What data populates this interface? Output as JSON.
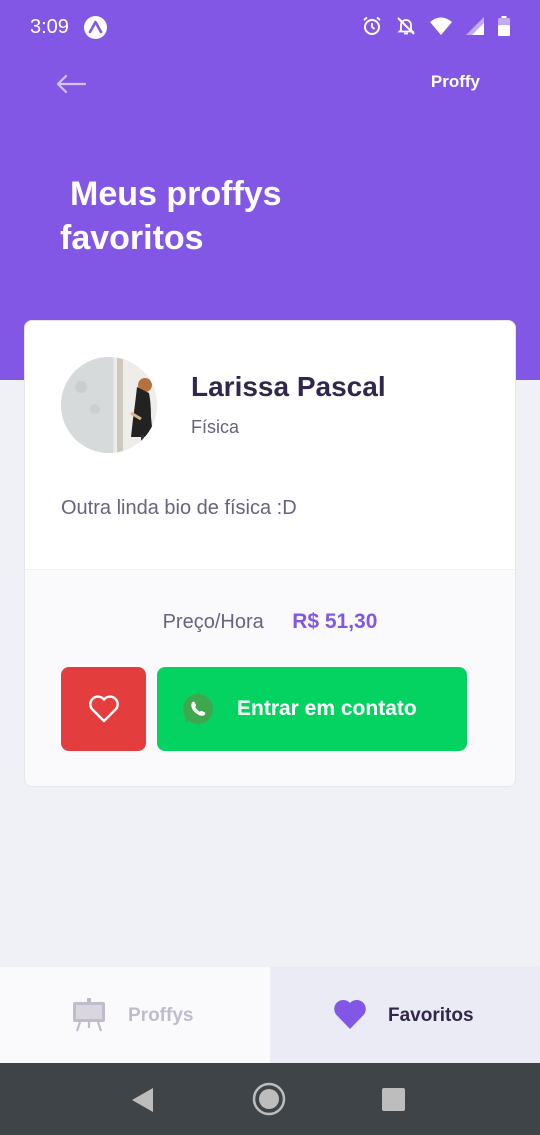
{
  "status_bar": {
    "time": "3:09",
    "icons": [
      "app-a-icon",
      "alarm-icon",
      "notifications-off-icon",
      "wifi-icon",
      "signal-icon",
      "battery-icon"
    ]
  },
  "header": {
    "brand": "Proffy",
    "title_line1": "Meus proffys",
    "title_line2": "favoritos",
    "back_icon": "arrow-left-icon"
  },
  "teacher_card": {
    "name": "Larissa Pascal",
    "subject": "Física",
    "bio": "Outra linda bio de física :D",
    "price_label": "Preço/Hora",
    "price_value": "R$ 51,30",
    "favorite_icon": "heart-outline-icon",
    "contact_label": "Entrar em contato",
    "contact_icon": "whatsapp-icon"
  },
  "tabs": [
    {
      "label": "Proffys",
      "icon": "easel-icon",
      "active": false
    },
    {
      "label": "Favoritos",
      "icon": "heart-icon",
      "active": true
    }
  ],
  "colors": {
    "primary": "#8257E5",
    "favorite": "#E33D3D",
    "whatsapp": "#04D361",
    "title_text": "#32264D",
    "body_text": "#6A6180",
    "background": "#F0F0F7",
    "nav_bar": "#3E4447"
  }
}
